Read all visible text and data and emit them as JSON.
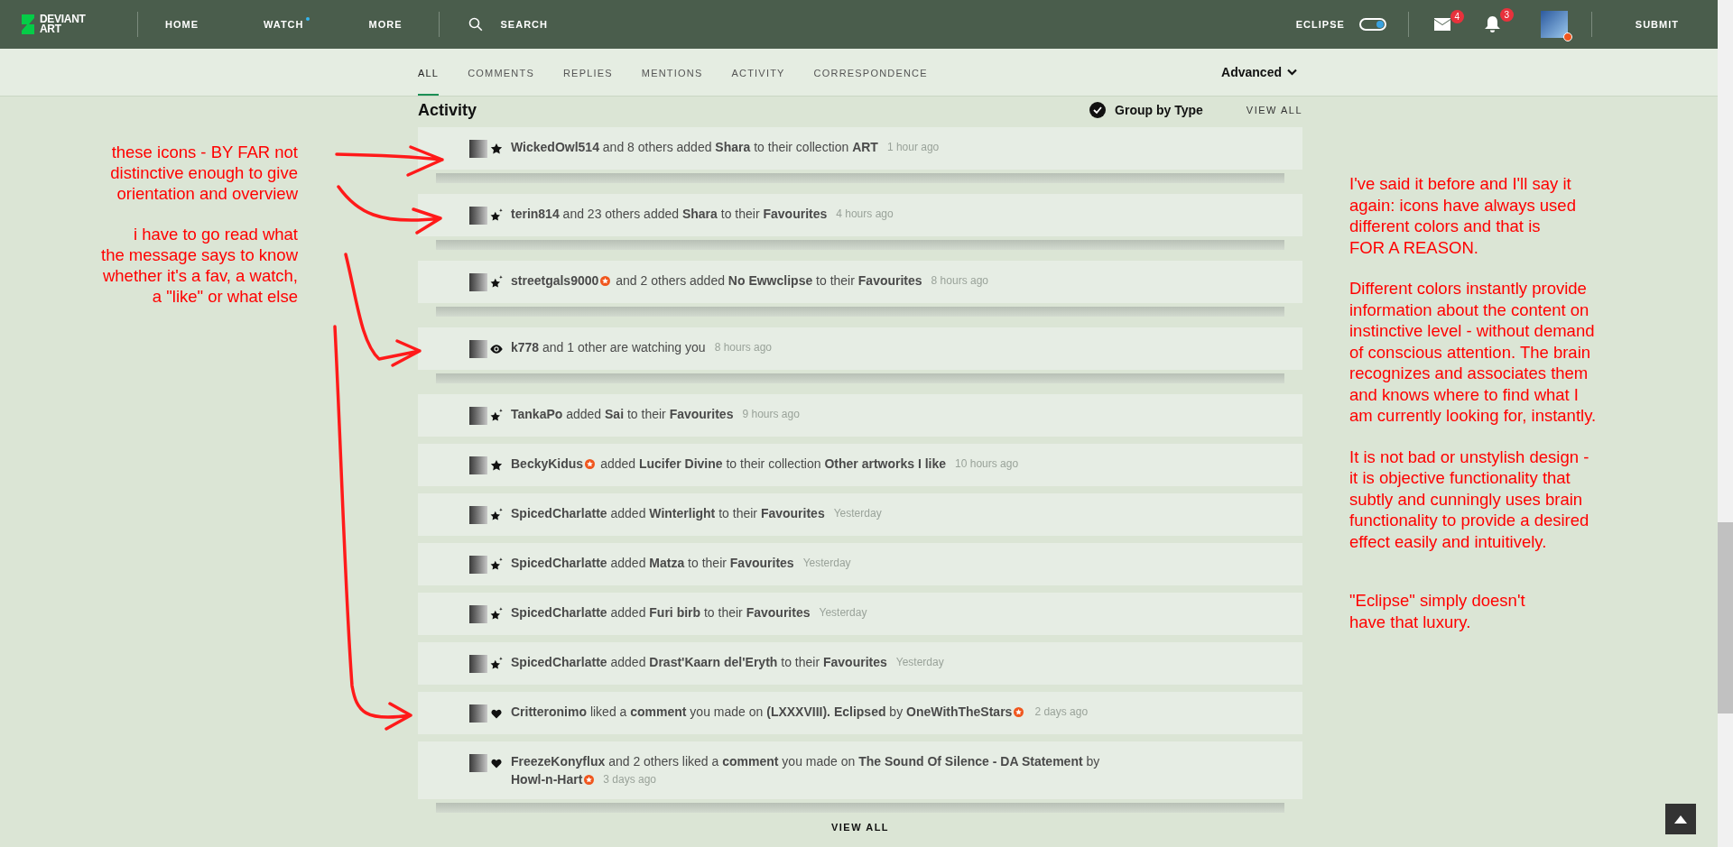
{
  "topbar": {
    "logo": [
      "DEVIANT",
      "ART"
    ],
    "nav": [
      {
        "label": "HOME",
        "dot": false
      },
      {
        "label": "WATCH",
        "dot": true
      },
      {
        "label": "MORE",
        "dot": false
      }
    ],
    "search": "SEARCH",
    "eclipse": {
      "label": "ECLIPSE",
      "on": true
    },
    "mail_count": "4",
    "notification_count": "3",
    "submit": "SUBMIT"
  },
  "tabs": [
    {
      "label": "ALL",
      "selected": true
    },
    {
      "label": "COMMENTS",
      "selected": false
    },
    {
      "label": "REPLIES",
      "selected": false
    },
    {
      "label": "MENTIONS",
      "selected": false
    },
    {
      "label": "ACTIVITY",
      "selected": false
    },
    {
      "label": "CORRESPONDENCE",
      "selected": false
    }
  ],
  "advanced": "Advanced",
  "activity": {
    "title": "Activity",
    "group_by_type": {
      "label": "Group by Type",
      "checked": true
    },
    "view_all": "VIEW ALL",
    "items": [
      {
        "kind": "collection",
        "stacked": true,
        "parts": [
          {
            "text": "**WickedOwl514** and 8 others added **Shara** to their collection **ART**",
            "badge": false
          }
        ],
        "time": "1 hour ago"
      },
      {
        "kind": "favourite",
        "stacked": true,
        "parts": [
          {
            "text": "**terin814** and 23 others added **Shara** to their **Favourites**",
            "badge": false
          }
        ],
        "time": "4 hours ago"
      },
      {
        "kind": "favourite",
        "stacked": true,
        "parts": [
          {
            "text": "**streetgals9000**",
            "badge": true
          },
          {
            "text": "and 2 others added **No Ewwclipse** to their **Favourites**",
            "badge": false
          }
        ],
        "time": "8 hours ago"
      },
      {
        "kind": "watch",
        "stacked": true,
        "parts": [
          {
            "text": "**k778** and 1 other are watching you",
            "badge": false
          }
        ],
        "time": "8 hours ago"
      },
      {
        "kind": "favourite",
        "stacked": false,
        "parts": [
          {
            "text": "**TankaPo** added **Sai** to their **Favourites**",
            "badge": false
          }
        ],
        "time": "9 hours ago"
      },
      {
        "kind": "collection",
        "stacked": false,
        "parts": [
          {
            "text": "**BeckyKidus**",
            "badge": true
          },
          {
            "text": "added **Lucifer Divine** to their collection **Other artworks I like**",
            "badge": false
          }
        ],
        "time": "10 hours ago"
      },
      {
        "kind": "favourite",
        "stacked": false,
        "parts": [
          {
            "text": "**SpicedCharlatte** added **Winterlight** to their **Favourites**",
            "badge": false
          }
        ],
        "time": "Yesterday"
      },
      {
        "kind": "favourite",
        "stacked": false,
        "parts": [
          {
            "text": "**SpicedCharlatte** added **Matza** to their **Favourites**",
            "badge": false
          }
        ],
        "time": "Yesterday"
      },
      {
        "kind": "favourite",
        "stacked": false,
        "parts": [
          {
            "text": "**SpicedCharlatte** added **Furi birb** to their **Favourites**",
            "badge": false
          }
        ],
        "time": "Yesterday"
      },
      {
        "kind": "favourite",
        "stacked": false,
        "parts": [
          {
            "text": "**SpicedCharlatte** added **Drast'Kaarn del'Eryth** to their **Favourites**",
            "badge": false
          }
        ],
        "time": "Yesterday"
      },
      {
        "kind": "like",
        "stacked": false,
        "parts": [
          {
            "text": "**Critteronimo** liked a **comment** you made on **(LXXXVIII). Eclipsed** by **OneWithTheStars**",
            "badge": true
          }
        ],
        "time": "2 days ago"
      },
      {
        "kind": "like",
        "stacked": true,
        "parts": [
          {
            "text": "**FreezeKonyflux** and 2 others liked a **comment** you made on **The Sound Of Silence - DA Statement** by",
            "badge": false
          },
          {
            "text": "**Howl-n-Hart**",
            "badge": true
          }
        ],
        "time": "3 days ago"
      }
    ],
    "bottom_view_all": "VIEW ALL"
  },
  "annotations": {
    "left": [
      "these icons - BY FAR not\ndistinctive enough to give\norientation and overview",
      "i have to go read what\nthe message says to know\nwhether it's a fav, a watch,\na \"like\" or what else"
    ],
    "right": [
      "I've said it before and I'll say it\nagain: icons have always used\ndifferent colors and that is\nFOR A REASON.",
      "Different colors instantly provide\ninformation about the content on\ninstinctive level - without demand\nof conscious attention. The brain\nrecognizes and associates them\nand knows where to find what I\nam currently looking for, instantly.",
      "It is not bad or unstylish design -\nit is objective functionality that\nsubtly and cunningly uses brain\nfunctionality to provide a desired\neffect easily and intuitively.",
      "\"Eclipse\" simply doesn't\nhave that luxury."
    ]
  }
}
